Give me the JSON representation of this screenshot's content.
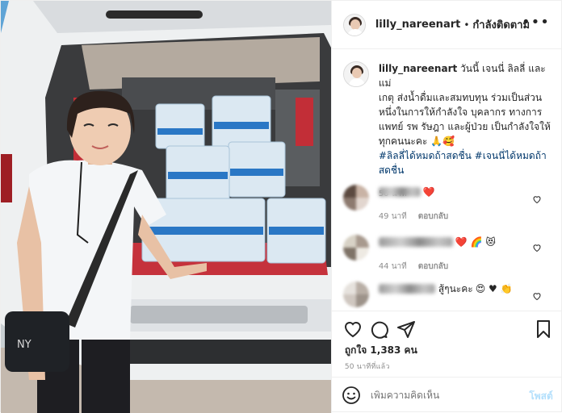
{
  "header": {
    "username": "lilly_nareenart",
    "separator": "•",
    "follow_status": "กำลังติดตาม",
    "more_label": "•••"
  },
  "caption": {
    "username": "lilly_nareenart",
    "text_lines": [
      " วันนี้ เจนนี่ ลิลลี่ และแม่",
      "เกตุ ส่งน้ำดื่มและสมทบทุน ร่วมเป็นส่วน",
      "หนึ่งในการให้กำลังใจ บุคลากร ทางการ",
      "แพทย์ รพ รัษฎา และผู้ป่วย เป็นกำลังใจให้",
      "ทุกคนนะคะ 🙏🥰"
    ],
    "hashtags": [
      "#ลิลลี่ได้หมดถ้าสดชื่น",
      "#เจนนี่ได้หมดถ้า",
      "สดชื่น"
    ],
    "time": "50 นาที"
  },
  "comments": [
    {
      "text": "",
      "emoji": "❤️",
      "time": "49 นาที",
      "reply": "ตอบกลับ"
    },
    {
      "text": "",
      "emoji": "❤️ 🌈 😻",
      "time": "44 นาที",
      "reply": "ตอบกลับ"
    },
    {
      "text": "สู้ๆนะคะ",
      "emoji": "😍 ♥ 👏",
      "time": "",
      "reply": ""
    }
  ],
  "actions": {
    "likes": "ถูกใจ 1,383 คน",
    "post_time": "50 นาทีที่แล้ว"
  },
  "add_comment": {
    "placeholder": "เพิ่มความคิดเห็น",
    "post_label": "โพสต์"
  },
  "icons": {
    "like": "heart-icon",
    "comment": "comment-bubble-icon",
    "share": "paper-plane-icon",
    "save": "bookmark-icon",
    "emoji": "smiley-icon"
  },
  "colors": {
    "link": "#00376b",
    "post_button_disabled": "#b2dffc",
    "muted": "#8e8e8e",
    "heart_red": "#ed4956"
  }
}
